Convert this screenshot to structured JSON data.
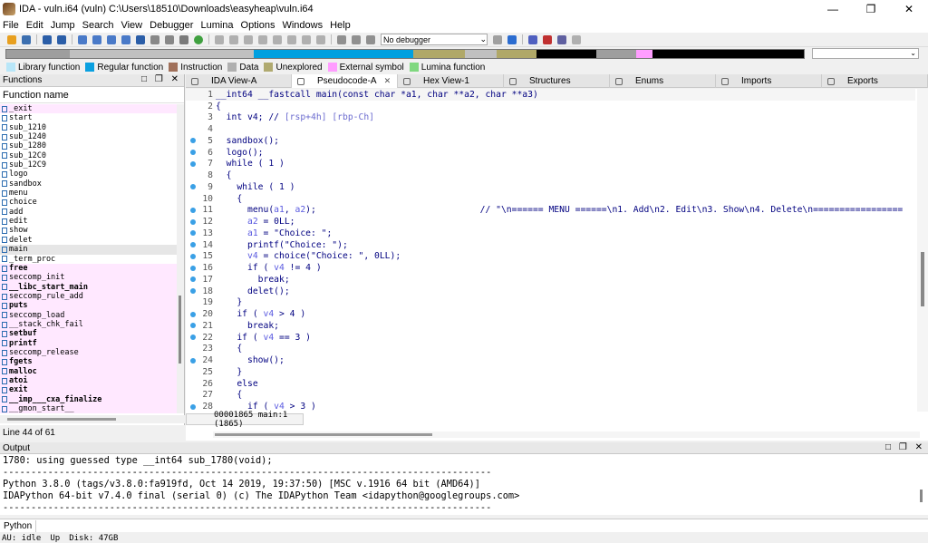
{
  "window": {
    "title": "IDA - vuln.i64 (vuln) C:\\Users\\18510\\Downloads\\easyheap\\vuln.i64",
    "controls": [
      "—",
      "❐",
      "✕"
    ]
  },
  "menu": [
    "File",
    "Edit",
    "Jump",
    "Search",
    "View",
    "Debugger",
    "Lumina",
    "Options",
    "Windows",
    "Help"
  ],
  "toolbar": {
    "debugger_select": "No debugger",
    "dropdown_arrow": "⌄"
  },
  "navband": {
    "segments": [
      {
        "color": "#9e9e9e",
        "frac": 0.08
      },
      {
        "color": "#c0c0c0",
        "frac": 0.23
      },
      {
        "color": "#00a0e0",
        "frac": 0.2
      },
      {
        "color": "#b0a868",
        "frac": 0.065
      },
      {
        "color": "#c0c0c0",
        "frac": 0.04
      },
      {
        "color": "#b0a868",
        "frac": 0.05
      },
      {
        "color": "#000000",
        "frac": 0.075
      },
      {
        "color": "#9e9e9e",
        "frac": 0.05
      },
      {
        "color": "#ff9dff",
        "frac": 0.02
      },
      {
        "color": "#000000",
        "frac": 0.19
      }
    ]
  },
  "legend": [
    {
      "label": "Library function",
      "color": "#b8e6f8"
    },
    {
      "label": "Regular function",
      "color": "#0aa0e0"
    },
    {
      "label": "Instruction",
      "color": "#a0705a"
    },
    {
      "label": "Data",
      "color": "#b0b0b0"
    },
    {
      "label": "Unexplored",
      "color": "#b0aa70"
    },
    {
      "label": "External symbol",
      "color": "#ff9dff"
    },
    {
      "label": "Lumina function",
      "color": "#7fd87f"
    }
  ],
  "functions_panel": {
    "title": "Functions",
    "controls": "□ ❐ ✕",
    "column": "Function name",
    "status": "Line 44 of 61",
    "scroll_position": 0.62,
    "items": [
      {
        "name": "_exit",
        "type": "lib",
        "bold": false
      },
      {
        "name": "start",
        "type": "regular",
        "bold": false
      },
      {
        "name": "sub_1210",
        "type": "regular",
        "bold": false
      },
      {
        "name": "sub_1240",
        "type": "regular",
        "bold": false
      },
      {
        "name": "sub_1280",
        "type": "regular",
        "bold": false
      },
      {
        "name": "sub_12C0",
        "type": "regular",
        "bold": false
      },
      {
        "name": "sub_12C9",
        "type": "regular",
        "bold": false
      },
      {
        "name": "logo",
        "type": "regular",
        "bold": false
      },
      {
        "name": "sandbox",
        "type": "regular",
        "bold": false
      },
      {
        "name": "menu",
        "type": "regular",
        "bold": false
      },
      {
        "name": "choice",
        "type": "regular",
        "bold": false
      },
      {
        "name": "add",
        "type": "regular",
        "bold": false
      },
      {
        "name": "edit",
        "type": "regular",
        "bold": false
      },
      {
        "name": "show",
        "type": "regular",
        "bold": false
      },
      {
        "name": "delet",
        "type": "regular",
        "bold": false
      },
      {
        "name": "main",
        "type": "selected",
        "bold": false
      },
      {
        "name": "_term_proc",
        "type": "regular",
        "bold": false
      },
      {
        "name": "free",
        "type": "lib",
        "bold": true
      },
      {
        "name": "seccomp_init",
        "type": "lib",
        "bold": false
      },
      {
        "name": "__libc_start_main",
        "type": "lib",
        "bold": true
      },
      {
        "name": "seccomp_rule_add",
        "type": "lib",
        "bold": false
      },
      {
        "name": "puts",
        "type": "lib",
        "bold": true
      },
      {
        "name": "seccomp_load",
        "type": "lib",
        "bold": false
      },
      {
        "name": "__stack_chk_fail",
        "type": "lib",
        "bold": false
      },
      {
        "name": "setbuf",
        "type": "lib",
        "bold": true
      },
      {
        "name": "printf",
        "type": "lib",
        "bold": true
      },
      {
        "name": "seccomp_release",
        "type": "lib",
        "bold": false
      },
      {
        "name": "fgets",
        "type": "lib",
        "bold": true
      },
      {
        "name": "malloc",
        "type": "lib",
        "bold": true
      },
      {
        "name": "atoi",
        "type": "lib",
        "bold": true
      },
      {
        "name": "exit",
        "type": "lib",
        "bold": true
      },
      {
        "name": "__imp___cxa_finalize",
        "type": "lib",
        "bold": true
      },
      {
        "name": "__gmon_start__",
        "type": "lib",
        "bold": false
      }
    ]
  },
  "tabs": [
    {
      "label": "IDA View-A",
      "active": false,
      "close": ""
    },
    {
      "label": "Pseudocode-A",
      "active": true,
      "close": "✕"
    },
    {
      "label": "Hex View-1",
      "active": false,
      "close": ""
    },
    {
      "label": "Structures",
      "active": false,
      "close": ""
    },
    {
      "label": "Enums",
      "active": false,
      "close": ""
    },
    {
      "label": "Imports",
      "active": false,
      "close": ""
    },
    {
      "label": "Exports",
      "active": false,
      "close": ""
    }
  ],
  "pseudocode": {
    "status": "00001865 main:1 (1865)",
    "lines": [
      {
        "n": "1",
        "dot": false,
        "hl": true,
        "segs": [
          {
            "t": "__int64 __fastcall main(const char *a1, char **a2, char **a3)",
            "c": "#000080"
          }
        ]
      },
      {
        "n": "2",
        "dot": false,
        "hl": false,
        "segs": [
          {
            "t": "{",
            "c": "#000080"
          }
        ]
      },
      {
        "n": "3",
        "dot": false,
        "hl": false,
        "segs": [
          {
            "t": "  int v4; // ",
            "c": "#000080"
          },
          {
            "t": "[rsp+4h] [rbp-Ch]",
            "c": "#6b6bcf"
          }
        ]
      },
      {
        "n": "4",
        "dot": false,
        "hl": false,
        "segs": [
          {
            "t": "",
            "c": "#000080"
          }
        ]
      },
      {
        "n": "5",
        "dot": true,
        "hl": false,
        "segs": [
          {
            "t": "  sandbox();",
            "c": "#000080"
          }
        ]
      },
      {
        "n": "6",
        "dot": true,
        "hl": false,
        "segs": [
          {
            "t": "  logo();",
            "c": "#000080"
          }
        ]
      },
      {
        "n": "7",
        "dot": true,
        "hl": false,
        "segs": [
          {
            "t": "  while ( 1 )",
            "c": "#000080"
          }
        ]
      },
      {
        "n": "8",
        "dot": false,
        "hl": false,
        "segs": [
          {
            "t": "  {",
            "c": "#000080"
          }
        ]
      },
      {
        "n": "9",
        "dot": true,
        "hl": false,
        "segs": [
          {
            "t": "    while ( 1 )",
            "c": "#000080"
          }
        ]
      },
      {
        "n": "10",
        "dot": false,
        "hl": false,
        "segs": [
          {
            "t": "    {",
            "c": "#000080"
          }
        ]
      },
      {
        "n": "11",
        "dot": true,
        "hl": false,
        "segs": [
          {
            "t": "      menu(",
            "c": "#000080"
          },
          {
            "t": "a1",
            "c": "#5a5ae0"
          },
          {
            "t": ", ",
            "c": "#000080"
          },
          {
            "t": "a2",
            "c": "#5a5ae0"
          },
          {
            "t": ");",
            "c": "#000080"
          },
          {
            "t": "                               // \"\\n====== MENU ======\\n1. Add\\n2. Edit\\n3. Show\\n4. Delete\\n=================",
            "c": "#000080"
          }
        ]
      },
      {
        "n": "12",
        "dot": true,
        "hl": false,
        "segs": [
          {
            "t": "      ",
            "c": "#000080"
          },
          {
            "t": "a2",
            "c": "#5a5ae0"
          },
          {
            "t": " = 0LL;",
            "c": "#000080"
          }
        ]
      },
      {
        "n": "13",
        "dot": true,
        "hl": false,
        "segs": [
          {
            "t": "      ",
            "c": "#000080"
          },
          {
            "t": "a1",
            "c": "#5a5ae0"
          },
          {
            "t": " = \"Choice: \";",
            "c": "#000080"
          }
        ]
      },
      {
        "n": "14",
        "dot": true,
        "hl": false,
        "segs": [
          {
            "t": "      printf(\"Choice: \");",
            "c": "#000080"
          }
        ]
      },
      {
        "n": "15",
        "dot": true,
        "hl": false,
        "segs": [
          {
            "t": "      ",
            "c": "#000080"
          },
          {
            "t": "v4",
            "c": "#5a5ae0"
          },
          {
            "t": " = choice(\"Choice: \", 0LL);",
            "c": "#000080"
          }
        ]
      },
      {
        "n": "16",
        "dot": true,
        "hl": false,
        "segs": [
          {
            "t": "      if ( ",
            "c": "#000080"
          },
          {
            "t": "v4",
            "c": "#5a5ae0"
          },
          {
            "t": " != 4 )",
            "c": "#000080"
          }
        ]
      },
      {
        "n": "17",
        "dot": true,
        "hl": false,
        "segs": [
          {
            "t": "        break;",
            "c": "#000080"
          }
        ]
      },
      {
        "n": "18",
        "dot": true,
        "hl": false,
        "segs": [
          {
            "t": "      delet();",
            "c": "#000080"
          }
        ]
      },
      {
        "n": "19",
        "dot": false,
        "hl": false,
        "segs": [
          {
            "t": "    }",
            "c": "#000080"
          }
        ]
      },
      {
        "n": "20",
        "dot": true,
        "hl": false,
        "segs": [
          {
            "t": "    if ( ",
            "c": "#000080"
          },
          {
            "t": "v4",
            "c": "#5a5ae0"
          },
          {
            "t": " > 4 )",
            "c": "#000080"
          }
        ]
      },
      {
        "n": "21",
        "dot": true,
        "hl": false,
        "segs": [
          {
            "t": "      break;",
            "c": "#000080"
          }
        ]
      },
      {
        "n": "22",
        "dot": true,
        "hl": false,
        "segs": [
          {
            "t": "    if ( ",
            "c": "#000080"
          },
          {
            "t": "v4",
            "c": "#5a5ae0"
          },
          {
            "t": " == 3 )",
            "c": "#000080"
          }
        ]
      },
      {
        "n": "23",
        "dot": false,
        "hl": false,
        "segs": [
          {
            "t": "    {",
            "c": "#000080"
          }
        ]
      },
      {
        "n": "24",
        "dot": true,
        "hl": false,
        "segs": [
          {
            "t": "      show();",
            "c": "#000080"
          }
        ]
      },
      {
        "n": "25",
        "dot": false,
        "hl": false,
        "segs": [
          {
            "t": "    }",
            "c": "#000080"
          }
        ]
      },
      {
        "n": "26",
        "dot": false,
        "hl": false,
        "segs": [
          {
            "t": "    else",
            "c": "#000080"
          }
        ]
      },
      {
        "n": "27",
        "dot": false,
        "hl": false,
        "segs": [
          {
            "t": "    {",
            "c": "#000080"
          }
        ]
      },
      {
        "n": "28",
        "dot": true,
        "hl": false,
        "segs": [
          {
            "t": "      if ( ",
            "c": "#000080"
          },
          {
            "t": "v4",
            "c": "#5a5ae0"
          },
          {
            "t": " > 3 )",
            "c": "#000080"
          }
        ]
      }
    ]
  },
  "output": {
    "title": "Output",
    "controls": "□ ❐ ✕",
    "lines": [
      "1780: using guessed type __int64 sub_1780(void);",
      "---------------------------------------------------------------------------------------",
      "Python 3.8.0 (tags/v3.8.0:fa919fd, Oct 14 2019, 19:37:50) [MSC v.1916 64 bit (AMD64)]",
      "IDAPython 64-bit v7.4.0 final (serial 0) (c) The IDAPython Team <idapython@googlegroups.com>",
      "---------------------------------------------------------------------------------------"
    ]
  },
  "python_button": "Python",
  "statusbar": [
    "AU:  idle",
    "Up",
    "Disk: 47GB"
  ]
}
